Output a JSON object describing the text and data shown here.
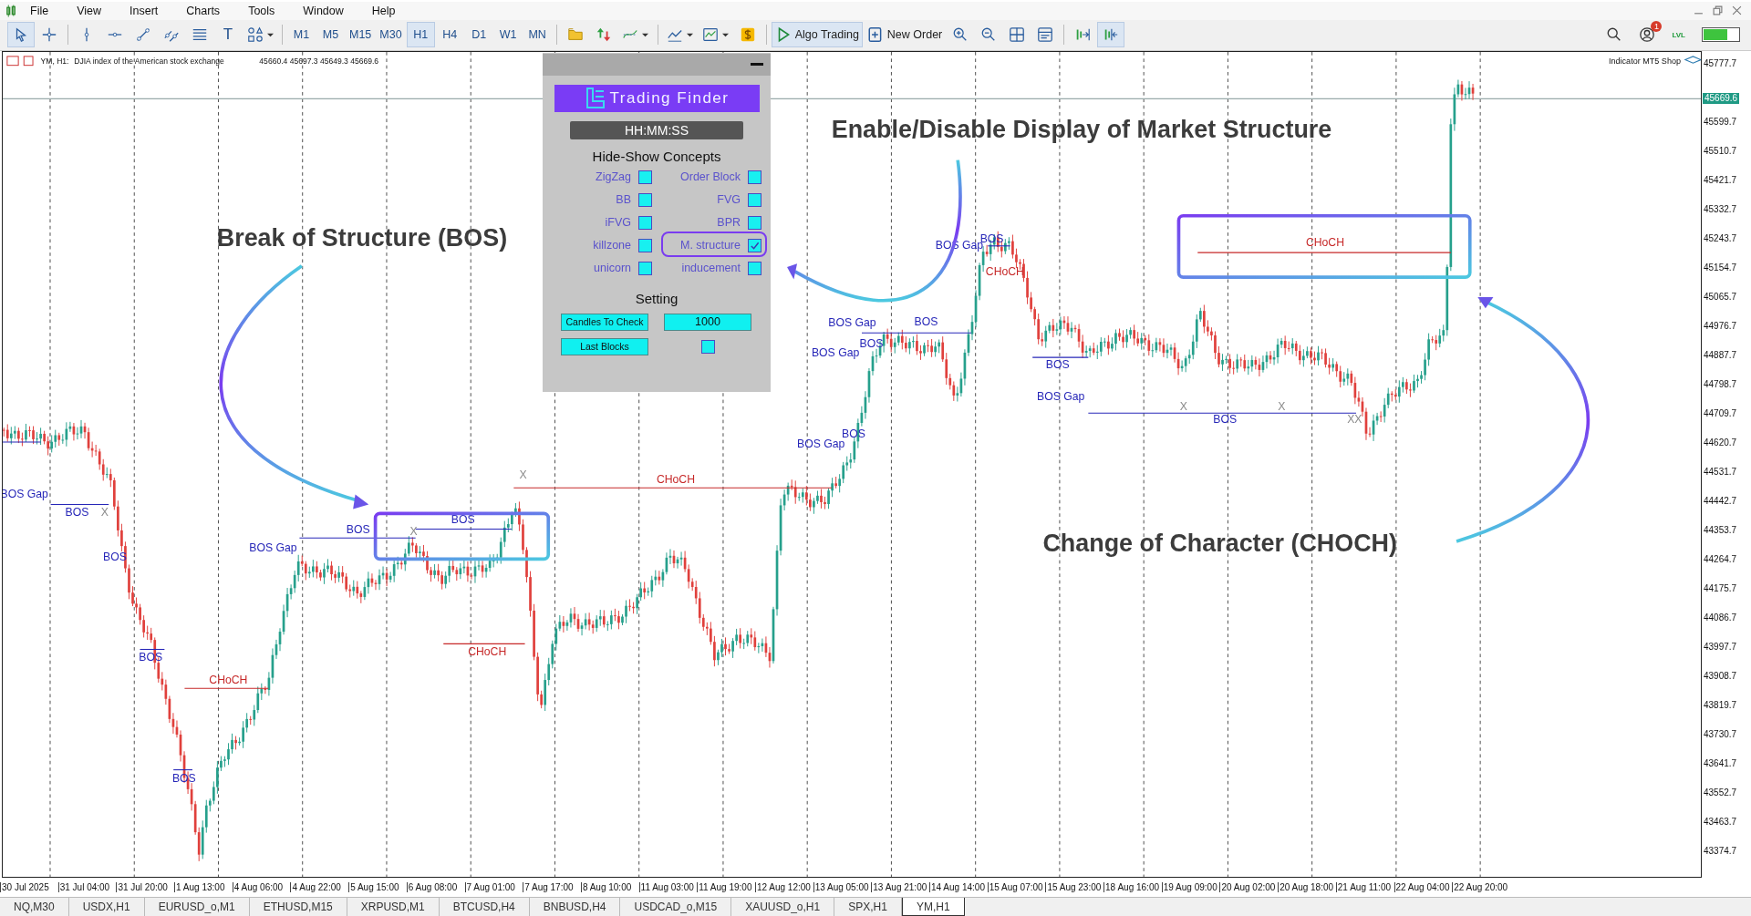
{
  "menu": [
    "File",
    "View",
    "Insert",
    "Charts",
    "Tools",
    "Window",
    "Help"
  ],
  "toolbar": [
    {
      "kind": "pointer",
      "selected": true
    },
    {
      "kind": "crosshair",
      "selected": false
    },
    {
      "kind": "separator"
    },
    {
      "kind": "vline",
      "selected": false
    },
    {
      "kind": "hline",
      "selected": false
    },
    {
      "kind": "trendline",
      "selected": false
    },
    {
      "kind": "channel",
      "selected": false
    },
    {
      "kind": "fibo",
      "selected": false
    },
    {
      "kind": "text",
      "glyph": "T",
      "selected": false
    },
    {
      "kind": "shapes",
      "selected": false,
      "dropdown": true
    },
    {
      "kind": "separator"
    },
    {
      "kind": "timeframe",
      "label": "M1",
      "selected": false
    },
    {
      "kind": "timeframe",
      "label": "M5",
      "selected": false
    },
    {
      "kind": "timeframe",
      "label": "M15",
      "selected": false
    },
    {
      "kind": "timeframe",
      "label": "M30",
      "selected": false
    },
    {
      "kind": "timeframe",
      "label": "H1",
      "selected": true
    },
    {
      "kind": "timeframe",
      "label": "H4",
      "selected": false
    },
    {
      "kind": "timeframe",
      "label": "D1",
      "selected": false
    },
    {
      "kind": "timeframe",
      "label": "W1",
      "selected": false
    },
    {
      "kind": "timeframe",
      "label": "MN",
      "selected": false
    },
    {
      "kind": "separator"
    },
    {
      "kind": "folder",
      "selected": false
    },
    {
      "kind": "trade",
      "selected": false
    },
    {
      "kind": "indicator",
      "selected": false,
      "dropdown": true
    },
    {
      "kind": "separator"
    },
    {
      "kind": "linechart",
      "selected": false,
      "dropdown": true
    },
    {
      "kind": "template",
      "selected": false,
      "dropdown": true
    },
    {
      "kind": "dollar",
      "selected": false
    },
    {
      "kind": "separator"
    },
    {
      "kind": "algo",
      "label": "Algo Trading",
      "selected": true
    },
    {
      "kind": "order",
      "label": "New Order",
      "selected": false
    },
    {
      "kind": "zoomin",
      "selected": false
    },
    {
      "kind": "zoomout",
      "selected": false
    },
    {
      "kind": "tile",
      "selected": false
    },
    {
      "kind": "properties",
      "selected": false
    },
    {
      "kind": "separator"
    },
    {
      "kind": "shift",
      "selected": false
    },
    {
      "kind": "autoscroll",
      "selected": true
    }
  ],
  "notifications": "1",
  "level_badge": "LVL",
  "chart": {
    "symbol": "YM, H1:",
    "description": "DJIA index of the American stock exchange",
    "ohlc": "45660.4 45697.3 45649.3 45669.6",
    "shop_label": "Indicator MT5 Shop",
    "price_ticks": [
      "45777.7",
      "45599.7",
      "45510.7",
      "45421.7",
      "45332.7",
      "45243.7",
      "45154.7",
      "45065.7",
      "44976.7",
      "44887.7",
      "44798.7",
      "44709.7",
      "44620.7",
      "44531.7",
      "44442.7",
      "44353.7",
      "44264.7",
      "44175.7",
      "44086.7",
      "43997.7",
      "43908.7",
      "43819.7",
      "43730.7",
      "43641.7",
      "43552.7",
      "43463.7",
      "43374.7"
    ],
    "current_price": "45669.6",
    "time_ticks": [
      "30 Jul 2025",
      "31 Jul 04:00",
      "31 Jul 20:00",
      "1 Aug 13:00",
      "4 Aug 06:00",
      "4 Aug 22:00",
      "5 Aug 15:00",
      "6 Aug 08:00",
      "7 Aug 01:00",
      "7 Aug 17:00",
      "8 Aug 10:00",
      "11 Aug 03:00",
      "11 Aug 19:00",
      "12 Aug 12:00",
      "13 Aug 05:00",
      "13 Aug 21:00",
      "14 Aug 14:00",
      "15 Aug 07:00",
      "15 Aug 23:00",
      "18 Aug 16:00",
      "19 Aug 09:00",
      "20 Aug 02:00",
      "20 Aug 18:00",
      "21 Aug 11:00",
      "22 Aug 04:00",
      "22 Aug 20:00"
    ],
    "markers": [
      {
        "text": "BOS Gap",
        "kind": "bos"
      },
      {
        "text": "BOS",
        "kind": "bos"
      },
      {
        "text": "X",
        "kind": "x"
      },
      {
        "text": "BOS",
        "kind": "bos"
      },
      {
        "text": "BOS",
        "kind": "bos"
      },
      {
        "text": "CHoCH",
        "kind": "choch"
      },
      {
        "text": "BOS",
        "kind": "bos"
      },
      {
        "text": "BOS Gap",
        "kind": "bos"
      },
      {
        "text": "BOS",
        "kind": "bos"
      },
      {
        "text": "X",
        "kind": "x"
      },
      {
        "text": "BOS",
        "kind": "bos"
      },
      {
        "text": "X",
        "kind": "x"
      },
      {
        "text": "CHoCH",
        "kind": "choch"
      },
      {
        "text": "CHoCH",
        "kind": "choch"
      },
      {
        "text": "BOS Gap",
        "kind": "bos"
      },
      {
        "text": "BOS Gap",
        "kind": "bos"
      },
      {
        "text": "BOS",
        "kind": "bos"
      },
      {
        "text": "BOS",
        "kind": "bos"
      },
      {
        "text": "BOS",
        "kind": "bos"
      },
      {
        "text": "BOS Gap",
        "kind": "bos"
      },
      {
        "text": "BOS Gap",
        "kind": "bos"
      },
      {
        "text": "BOS",
        "kind": "bos"
      },
      {
        "text": "CHoCH",
        "kind": "choch"
      },
      {
        "text": "BOS",
        "kind": "bos"
      },
      {
        "text": "BOS Gap",
        "kind": "bos"
      },
      {
        "text": "BOS",
        "kind": "bos"
      },
      {
        "text": "X",
        "kind": "x"
      },
      {
        "text": "X",
        "kind": "x"
      },
      {
        "text": "XX",
        "kind": "x"
      },
      {
        "text": "CHoCH",
        "kind": "choch"
      }
    ],
    "callouts": [
      "Break of Structure (BOS)",
      "Enable/Disable Display of Market Structure",
      "Change of Character (CHOCH)"
    ]
  },
  "panel": {
    "brand": "Trading Finder",
    "clock": "HH:MM:SS",
    "concepts_title": "Hide-Show Concepts",
    "checks": [
      {
        "label": "ZigZag",
        "checked": false,
        "highlighted": false
      },
      {
        "label": "Order Block",
        "checked": false,
        "highlighted": false
      },
      {
        "label": "BB",
        "checked": false,
        "highlighted": false
      },
      {
        "label": "FVG",
        "checked": false,
        "highlighted": false
      },
      {
        "label": "iFVG",
        "checked": false,
        "highlighted": false
      },
      {
        "label": "BPR",
        "checked": false,
        "highlighted": false
      },
      {
        "label": "killzone",
        "checked": false,
        "highlighted": false
      },
      {
        "label": "M. structure",
        "checked": true,
        "highlighted": true
      },
      {
        "label": "unicorn",
        "checked": false,
        "highlighted": false
      },
      {
        "label": "inducement",
        "checked": false,
        "highlighted": false
      }
    ],
    "setting_title": "Setting",
    "candles_button": "Candles To Check",
    "candles_value": "1000",
    "last_blocks": {
      "label": "Last Blocks",
      "checked": false
    }
  },
  "tabs": [
    {
      "label": "NQ,M30",
      "selected": false
    },
    {
      "label": "USDX,H1",
      "selected": false
    },
    {
      "label": "EURUSD_o,M1",
      "selected": false
    },
    {
      "label": "ETHUSD,M15",
      "selected": false
    },
    {
      "label": "XRPUSD,M1",
      "selected": false
    },
    {
      "label": "BTCUSD,H4",
      "selected": false
    },
    {
      "label": "BNBUSD,H4",
      "selected": false
    },
    {
      "label": "USDCAD_o,M15",
      "selected": false
    },
    {
      "label": "XAUUSD_o,H1",
      "selected": false
    },
    {
      "label": "SPX,H1",
      "selected": false
    },
    {
      "label": "YM,H1",
      "selected": true
    }
  ]
}
